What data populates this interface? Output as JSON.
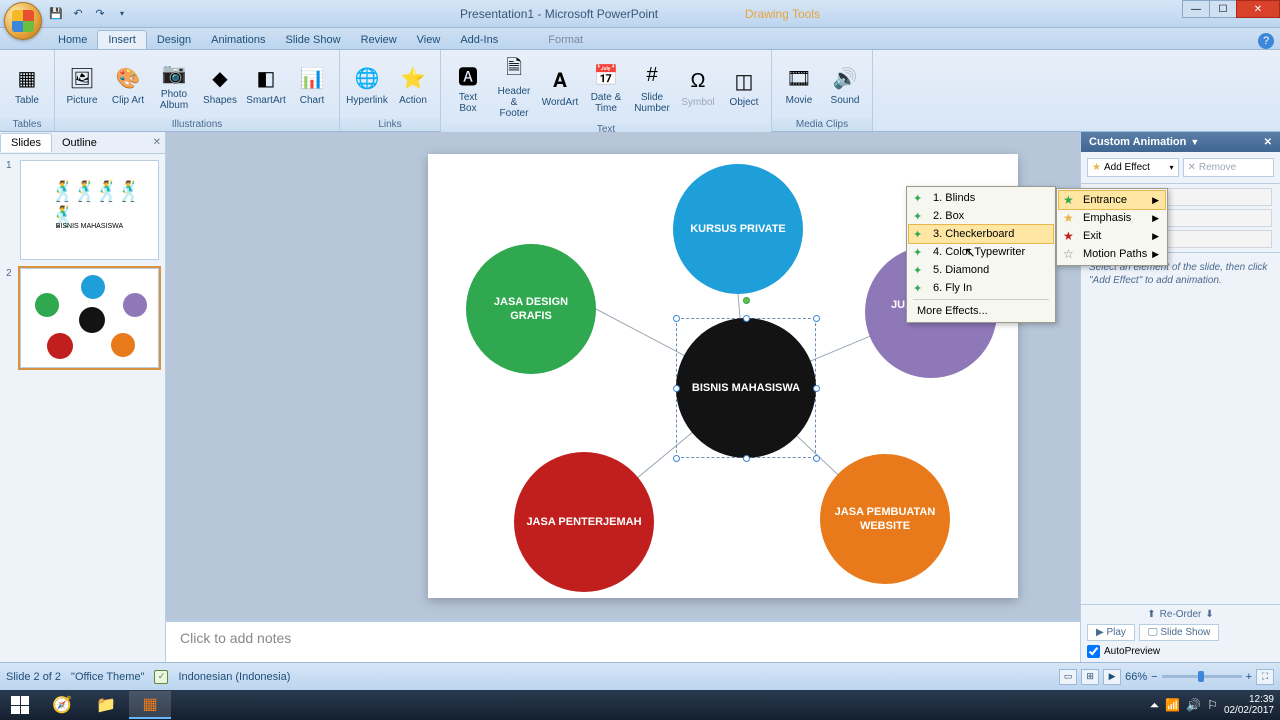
{
  "window": {
    "title": "Presentation1 - Microsoft PowerPoint",
    "context_tool": "Drawing Tools"
  },
  "tabs": {
    "home": "Home",
    "insert": "Insert",
    "design": "Design",
    "animations": "Animations",
    "slideshow": "Slide Show",
    "review": "Review",
    "view": "View",
    "addins": "Add-Ins",
    "format": "Format"
  },
  "ribbon": {
    "groups": {
      "tables": "Tables",
      "illustrations": "Illustrations",
      "links": "Links",
      "text": "Text",
      "mediaclips": "Media Clips"
    },
    "btns": {
      "table": "Table",
      "picture": "Picture",
      "clipart": "Clip\nArt",
      "photoalbum": "Photo\nAlbum",
      "shapes": "Shapes",
      "smartart": "SmartArt",
      "chart": "Chart",
      "hyperlink": "Hyperlink",
      "action": "Action",
      "textbox": "Text\nBox",
      "headerfooter": "Header\n& Footer",
      "wordart": "WordArt",
      "datetime": "Date\n& Time",
      "slidenumber": "Slide\nNumber",
      "symbol": "Symbol",
      "object": "Object",
      "movie": "Movie",
      "sound": "Sound"
    }
  },
  "slides_panel": {
    "tab_slides": "Slides",
    "tab_outline": "Outline",
    "s1_caption": "BISNIS MAHASISWA"
  },
  "slide": {
    "blue": "KURSUS PRIVATE",
    "green": "JASA DESIGN GRAFIS",
    "purple": "JUAL BARANG BEKAS",
    "black": "BISNIS MAHASISWA",
    "red": "JASA PENTERJEMAH",
    "orange": "JASA PEMBUATAN WEBSITE"
  },
  "notes": {
    "placeholder": "Click to add notes"
  },
  "taskpane": {
    "title": "Custom Animation",
    "add_effect": "Add Effect",
    "remove": "Remove",
    "hint": "Select an element of the slide, then click \"Add Effect\" to add animation.",
    "reorder": "Re-Order",
    "play": "Play",
    "slideshow": "Slide Show",
    "autopreview": "AutoPreview"
  },
  "flyout_cat": {
    "entrance": "Entrance",
    "emphasis": "Emphasis",
    "exit": "Exit",
    "motion": "Motion Paths"
  },
  "flyout_eff": {
    "e1": "1. Blinds",
    "e2": "2. Box",
    "e3": "3. Checkerboard",
    "e4": "4. Color Typewriter",
    "e5": "5. Diamond",
    "e6": "6. Fly In",
    "more": "More Effects..."
  },
  "status": {
    "slide": "Slide 2 of 2",
    "theme": "\"Office Theme\"",
    "lang": "Indonesian (Indonesia)",
    "zoom": "66%"
  },
  "clock": {
    "time": "12:39",
    "date": "02/02/2017"
  }
}
